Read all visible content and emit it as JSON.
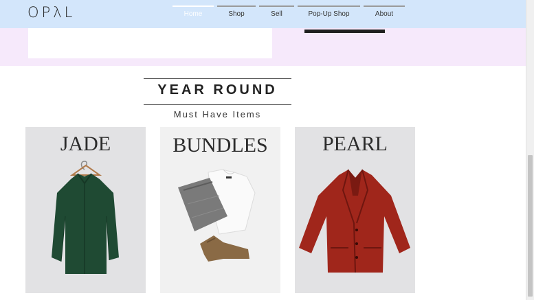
{
  "header": {
    "logo_text": "OPλL",
    "nav": [
      {
        "label": "Home",
        "active": true
      },
      {
        "label": "Shop",
        "active": false
      },
      {
        "label": "Sell",
        "active": false
      },
      {
        "label": "Pop-Up Shop",
        "active": false
      },
      {
        "label": "About",
        "active": false
      }
    ]
  },
  "section": {
    "title": "YEAR ROUND",
    "subtitle": "Must Have Items"
  },
  "cards": [
    {
      "title": "JADE",
      "image": "green-shirt-on-hanger"
    },
    {
      "title": "BUNDLES",
      "image": "folded-clothes-and-boots"
    },
    {
      "title": "PEARL",
      "image": "red-leather-jacket"
    }
  ],
  "colors": {
    "nav_bg": "#d3e6fb",
    "band_bg": "#f6e9fb",
    "card_bg": "#e2e2e4",
    "jade": "#1f4a33",
    "pearl": "#a0261b"
  }
}
